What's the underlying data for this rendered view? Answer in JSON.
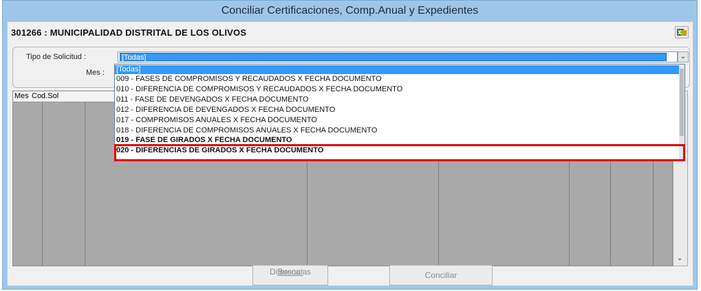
{
  "window": {
    "title": "Conciliar  Certificaciones, Comp.Anual y Expedientes"
  },
  "entity": {
    "label": "301266 : MUNICIPALIDAD DISTRITAL DE LOS OLIVOS"
  },
  "filters": {
    "tipo_label": "Tipo de Solicitud :",
    "tipo_value": "[Todas]",
    "mes_label": "Mes :"
  },
  "grid": {
    "columns": [
      "Mes",
      "Cod.Sol"
    ]
  },
  "dropdown": {
    "items": [
      "[Todas]",
      "009 - FASES DE COMPROMISOS Y RECAUDADOS X FECHA DOCUMENTO",
      "010 - DIFERENCIA DE COMPROMISOS Y RECAUDADOS X FECHA DOCUMENTO",
      "011 - FASE DE DEVENGADOS X FECHA DOCUMENTO",
      "012 - DIFERENCIA DE DEVENGADOS X FECHA DOCUMENTO",
      "017 - COMPROMISOS ANUALES X FECHA DOCUMENTO",
      "018 - DIFERENCIA DE COMPROMISOS ANUALES X FECHA DOCUMENTO",
      "019 - FASE DE GIRADOS X FECHA DOCUMENTO",
      "020 - DIFERENCIAS DE GIRADOS X FECHA DOCUMENTO"
    ]
  },
  "buttons": {
    "buscar_line1": "Buscar",
    "buscar_line2": "Diferencias",
    "conciliar": "Conciliar"
  },
  "colors": {
    "highlight": "#e30000",
    "selection": "#3399ff",
    "titlebar": "#9fc6e8"
  },
  "icons": {
    "export": "excel-export-icon",
    "combo_arrow": "chevron-down-icon"
  }
}
